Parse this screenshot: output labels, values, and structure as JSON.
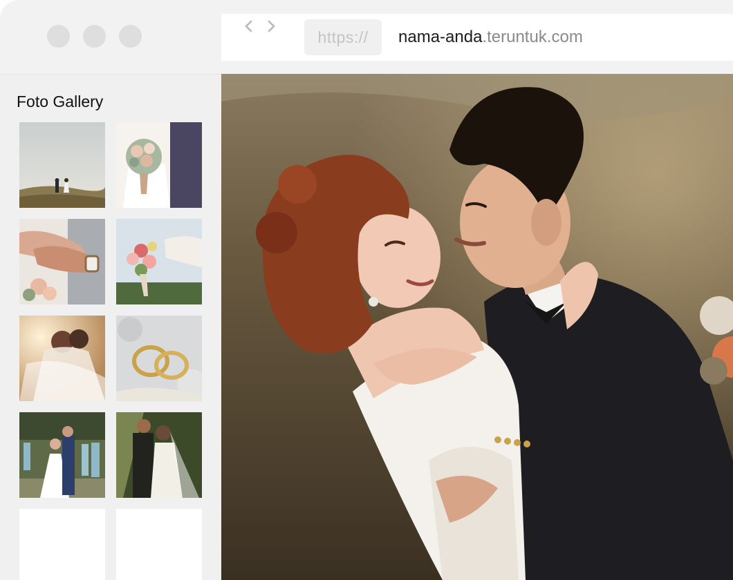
{
  "browser": {
    "window_controls": [
      "close-dot",
      "minimize-dot",
      "maximize-dot"
    ],
    "nav": {
      "back_icon": "chevron-left-icon",
      "forward_icon": "chevron-right-icon"
    },
    "address_bar": {
      "protocol": "https://",
      "host": "nama-anda",
      "domain": ".teruntuk.com"
    }
  },
  "sidebar": {
    "title": "Foto Gallery",
    "thumbnails": [
      {
        "subject": "couple-on-hill-photo"
      },
      {
        "subject": "bride-bouquet-photo"
      },
      {
        "subject": "holding-hands-photo"
      },
      {
        "subject": "flower-bouquet-photo"
      },
      {
        "subject": "veil-kiss-photo"
      },
      {
        "subject": "wedding-rings-photo"
      },
      {
        "subject": "ceremony-kiss-photo"
      },
      {
        "subject": "couple-smiling-photo"
      },
      {
        "subject": "empty-slot"
      },
      {
        "subject": "empty-slot"
      }
    ]
  },
  "main": {
    "photo": "couple-embrace-photo"
  },
  "colors": {
    "chrome": "#f2f2f2",
    "sidebar": "#f0f0f0",
    "url_host": "#1c1c1c",
    "url_domain": "#8a8a8a",
    "protocol": "#c4c4c4"
  }
}
